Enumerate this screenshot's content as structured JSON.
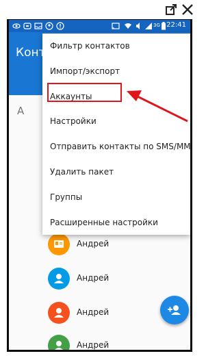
{
  "status_bar": {
    "time": "22:41",
    "network": "3G"
  },
  "app": {
    "title": "Конта"
  },
  "section_letter": "A",
  "menu": {
    "items": [
      {
        "label": "Фильтр контактов"
      },
      {
        "label": "Импорт/экспорт"
      },
      {
        "label": "Аккаунты"
      },
      {
        "label": "Настройки"
      },
      {
        "label": "Отправить контакты по SMS/MMS"
      },
      {
        "label": "Удалить пакет"
      },
      {
        "label": "Группы"
      },
      {
        "label": "Расширенные настройки"
      }
    ],
    "highlighted_item": "Импорт/экспорт"
  },
  "contacts": [
    {
      "name": "Андрей",
      "avatar_color": "#ff9800",
      "icon": "contact-card-icon"
    },
    {
      "name": "Андрей",
      "avatar_color": "#039be5",
      "icon": "person-icon"
    },
    {
      "name": "Андрей",
      "avatar_color": "#f4511e",
      "icon": "person-icon"
    },
    {
      "name": "Андрей",
      "avatar_color": "#43a047",
      "icon": "person-icon"
    }
  ],
  "fab": {
    "icon": "add-person-icon"
  },
  "colors": {
    "primary": "#1976d2",
    "status_bar": "#1565c0",
    "annotation": "#e0151b"
  }
}
